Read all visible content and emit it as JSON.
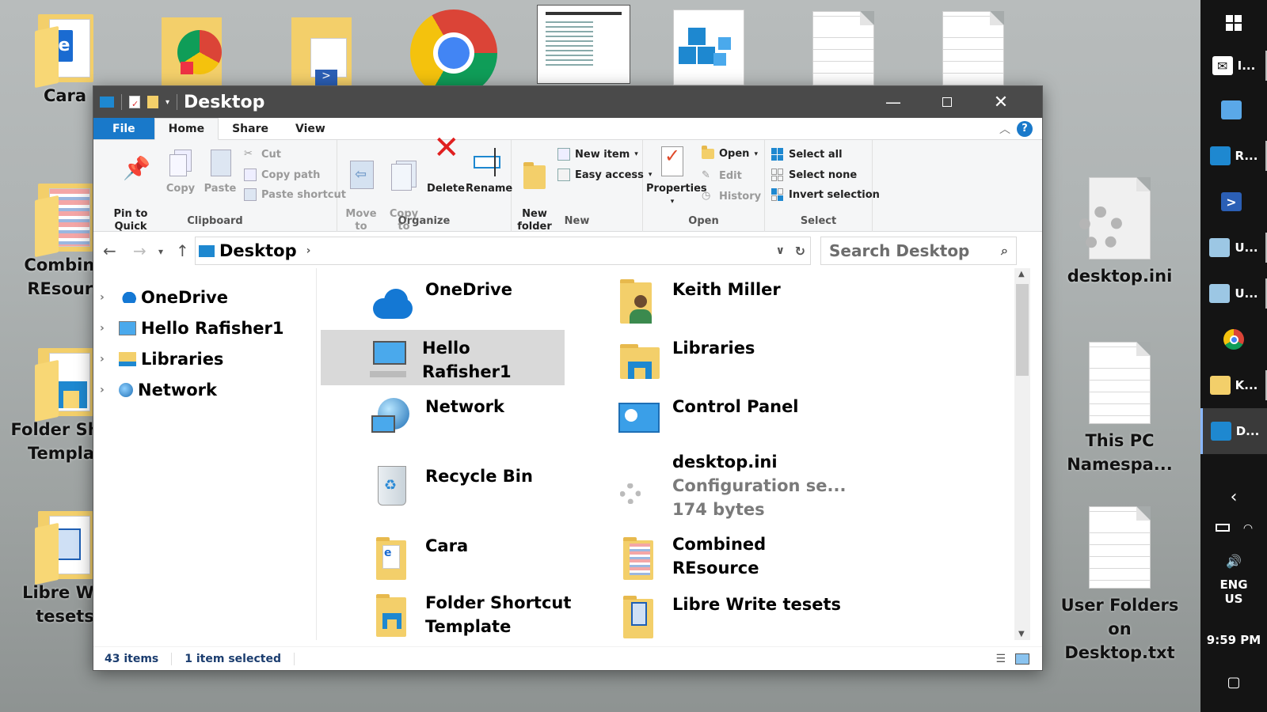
{
  "desktop": {
    "left_icons": [
      {
        "label": "Cara"
      },
      {
        "label": "Combine\nREsourc"
      },
      {
        "label": "Folder Shor\nTemplat"
      },
      {
        "label": "Libre Wri\ntesets"
      }
    ],
    "right_icons": [
      {
        "label": "desktop.ini"
      },
      {
        "label": "This PC\nNamespa..."
      },
      {
        "label": "User Folders on\nDesktop.txt"
      }
    ]
  },
  "taskbar": {
    "items": [
      {
        "label": "I..."
      },
      {
        "label": ""
      },
      {
        "label": "R..."
      },
      {
        "label": ""
      },
      {
        "label": "U..."
      },
      {
        "label": "U..."
      },
      {
        "label": ""
      },
      {
        "label": "K..."
      },
      {
        "label": "D..."
      }
    ],
    "lang": "ENG",
    "region": "US",
    "time": "9:59 PM"
  },
  "window": {
    "title": "Desktop",
    "tabs": [
      "File",
      "Home",
      "Share",
      "View"
    ],
    "ribbon": {
      "clipboard": {
        "pin": "Pin to Quick\naccess",
        "copy": "Copy",
        "paste": "Paste",
        "cut": "Cut",
        "copy_path": "Copy path",
        "paste_shortcut": "Paste shortcut",
        "label": "Clipboard"
      },
      "organize": {
        "move_to": "Move\nto",
        "copy_to": "Copy\nto",
        "delete": "Delete",
        "rename": "Rename",
        "label": "Organize"
      },
      "new": {
        "new_folder": "New\nfolder",
        "new_item": "New item",
        "easy_access": "Easy access",
        "label": "New"
      },
      "open": {
        "properties": "Properties",
        "open": "Open",
        "edit": "Edit",
        "history": "History",
        "label": "Open"
      },
      "select": {
        "select_all": "Select all",
        "select_none": "Select none",
        "invert": "Invert selection",
        "label": "Select"
      }
    },
    "address": "Desktop",
    "search_placeholder": "Search Desktop",
    "tree": [
      "OneDrive",
      "Hello Rafisher1",
      "Libraries",
      "Network"
    ],
    "items": [
      {
        "name": "OneDrive"
      },
      {
        "name": "Keith Miller"
      },
      {
        "name": "Hello Rafisher1"
      },
      {
        "name": "Libraries"
      },
      {
        "name": "Network"
      },
      {
        "name": "Control Panel"
      },
      {
        "name": "Recycle Bin"
      },
      {
        "name": "desktop.ini",
        "sub1": "Configuration se...",
        "sub2": "174 bytes"
      },
      {
        "name": "Cara"
      },
      {
        "name": "Combined\nREsource"
      },
      {
        "name": "Folder Shortcut\nTemplate"
      },
      {
        "name": "Libre Write tesets"
      }
    ],
    "status": {
      "count": "43 items",
      "selected": "1 item selected"
    }
  },
  "colors": {
    "accent": "#1979ca",
    "titlebar": "#4a4a4a",
    "taskbar": "#141414",
    "selection": "#d9d9d9"
  }
}
